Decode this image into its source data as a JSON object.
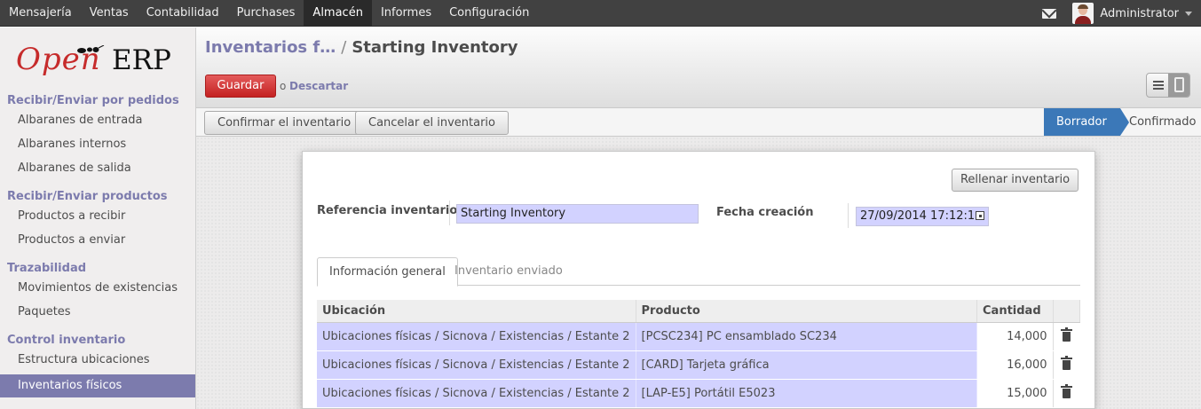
{
  "topbar": {
    "menu": [
      "Mensajería",
      "Ventas",
      "Contabilidad",
      "Purchases",
      "Almacén",
      "Informes",
      "Configuración"
    ],
    "active_menu": "Almacén",
    "user_name": "Administrator"
  },
  "sidebar": {
    "logo": {
      "open": "Open",
      "erp": "ERP"
    },
    "sections": [
      {
        "title": "Recibir/Enviar por pedidos",
        "items": [
          "Albaranes de entrada",
          "Albaranes internos",
          "Albaranes de salida"
        ]
      },
      {
        "title": "Recibir/Enviar productos",
        "items": [
          "Productos a recibir",
          "Productos a enviar"
        ]
      },
      {
        "title": "Trazabilidad",
        "items": [
          "Movimientos de existencias",
          "Paquetes"
        ]
      },
      {
        "title": "Control inventario",
        "items": [
          "Estructura ubicaciones",
          "Inventarios físicos"
        ]
      }
    ],
    "active_item": "Inventarios físicos"
  },
  "header": {
    "breadcrumb_parent": "Inventarios f…",
    "breadcrumb_sep": "/",
    "breadcrumb_current": "Starting Inventory",
    "save_label": "Guardar",
    "or_label": "o",
    "discard_label": "Descartar"
  },
  "statusbar": {
    "confirm_label": "Confirmar el inventario",
    "cancel_label": "Cancelar el inventario",
    "stages": [
      "Borrador",
      "Confirmado"
    ],
    "active_stage": "Borrador"
  },
  "form": {
    "fill_button": "Rellenar inventario",
    "ref_label": "Referencia inventario",
    "ref_value": "Starting Inventory",
    "date_label": "Fecha creación",
    "date_value": "27/09/2014 17:12:1",
    "tabs": [
      "Información general",
      "Inventario enviado"
    ],
    "active_tab": "Información general"
  },
  "table": {
    "columns": [
      "Ubicación",
      "Producto",
      "Cantidad"
    ],
    "rows": [
      {
        "location": "Ubicaciones físicas / Sicnova / Existencias / Estante 2",
        "product": "[PCSC234] PC ensamblado SC234",
        "qty": "14,000"
      },
      {
        "location": "Ubicaciones físicas / Sicnova / Existencias / Estante 2",
        "product": "[CARD] Tarjeta gráfica",
        "qty": "16,000"
      },
      {
        "location": "Ubicaciones físicas / Sicnova / Existencias / Estante 2",
        "product": "[LAP-E5] Portátil E5023",
        "qty": "15,000"
      }
    ]
  },
  "colors": {
    "topbar": "#414141",
    "accent": "#7c7bad",
    "save_button": "#dc2b2b",
    "active_stage": "#3b78b8",
    "required_field": "#d2d2ff"
  },
  "icons": [
    "mail-icon",
    "user-avatar",
    "caret-down-icon",
    "list-view-icon",
    "form-view-icon",
    "calendar-icon",
    "trash-icon"
  ]
}
